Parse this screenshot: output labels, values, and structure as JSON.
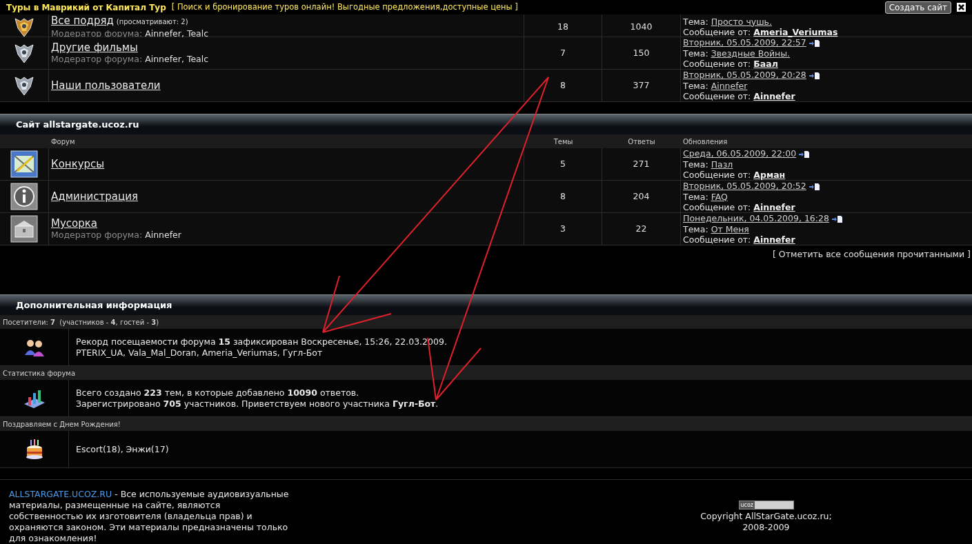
{
  "top_bar": {
    "title": "Туры в Маврикий от Капитал Тур",
    "tagline": "[ Поиск и бронирование туров онлайн! Выгодные предложения,доступные цены ]",
    "button": "Создать сайт"
  },
  "forums_top": [
    {
      "kind": "emblem_gold",
      "title": "Все подряд",
      "viewers": "(просматривают: 2)",
      "moderator_label": "Модератор форума:",
      "moderators": "Ainnefer, Tealc",
      "topics": "18",
      "replies": "1040",
      "topic_label": "Тема:",
      "topic": "Просто чушь.",
      "from_label": "Сообщение от:",
      "author": "Ameria_Veriumas"
    },
    {
      "kind": "emblem",
      "title": "Другие фильмы",
      "moderator_label": "Модератор форума:",
      "moderators": "Ainnefer, Tealc",
      "topics": "7",
      "replies": "150",
      "last_date": "Вторник, 05.05.2009, 22:57",
      "topic_label": "Тема:",
      "topic": "Звездные Войны.",
      "from_label": "Сообщение от:",
      "author": "Баал"
    },
    {
      "kind": "emblem",
      "title": "Наши пользователи",
      "topics": "8",
      "replies": "377",
      "last_date": "Вторник, 05.05.2009, 20:28",
      "topic_label": "Тема:",
      "topic": "Ainnefer",
      "from_label": "Сообщение от:",
      "author": "Ainnefer"
    }
  ],
  "section": {
    "title": "Сайт allstargate.ucoz.ru",
    "columns": [
      "Форум",
      "Темы",
      "Ответы",
      "Обновления"
    ],
    "forums": [
      {
        "kind": "contest",
        "title": "Конкурсы",
        "topics": "5",
        "replies": "271",
        "last_date": "Среда, 06.05.2009, 22:00",
        "topic_label": "Тема:",
        "topic": "Пазл",
        "from_label": "Сообщение от:",
        "author": "Арман"
      },
      {
        "kind": "info",
        "title": "Администрация",
        "topics": "8",
        "replies": "204",
        "last_date": "Вторник, 05.05.2009, 20:52",
        "topic_label": "Тема:",
        "topic": "FAQ",
        "from_label": "Сообщение от:",
        "author": "Ainnefer"
      },
      {
        "kind": "chest",
        "title": "Мусорка",
        "moderator_label": "Модератор форума:",
        "moderators": "Ainnefer",
        "topics": "3",
        "replies": "22",
        "last_date": "Понедельник, 04.05.2009, 16:28",
        "topic_label": "Тема:",
        "topic": "От Меня",
        "from_label": "Сообщение от:",
        "author": "Ainnefer"
      }
    ]
  },
  "mark_all_read": "[ Отметить все сообщения прочитанными ]",
  "info": {
    "title": "Дополнительная информация",
    "blocks": [
      {
        "heading": "Посетители: **7**  (участников - **4**, гостей - **3**)",
        "kind": "users",
        "lines": [
          "Рекорд посещаемости форума **15** зафиксирован Воскресенье, 15:26, 22.03.2009.",
          "PTERIX_UA, Vala_Mal_Doran, Ameria_Veriumas, Гугл-Бот"
        ]
      },
      {
        "heading": "Статистика форума",
        "kind": "stats",
        "lines": [
          "Всего создано **223** тем, в которые добавлено **10090** ответов.",
          "Зарегистрировано **705** участников. Приветствуем нового участника **Гугл-Бот**."
        ]
      },
      {
        "heading": "Поздравляем с Днем Рождения!",
        "kind": "cake",
        "lines": [
          "Escort(18), Энжи(17)"
        ]
      }
    ]
  },
  "footer": {
    "link": "ALLSTARGATE.UCOZ.RU",
    "text": " - Все используемые аудиовизуальные материалы, размещенные на сайте, являются собственностью их изготовителя (владельца прав) и охраняются законом. Эти материалы предназначены только для ознакомления!",
    "badge": "ucoz",
    "copyright": "Copyright AllStarGate.ucoz.ru;",
    "years": "2008-2009"
  }
}
